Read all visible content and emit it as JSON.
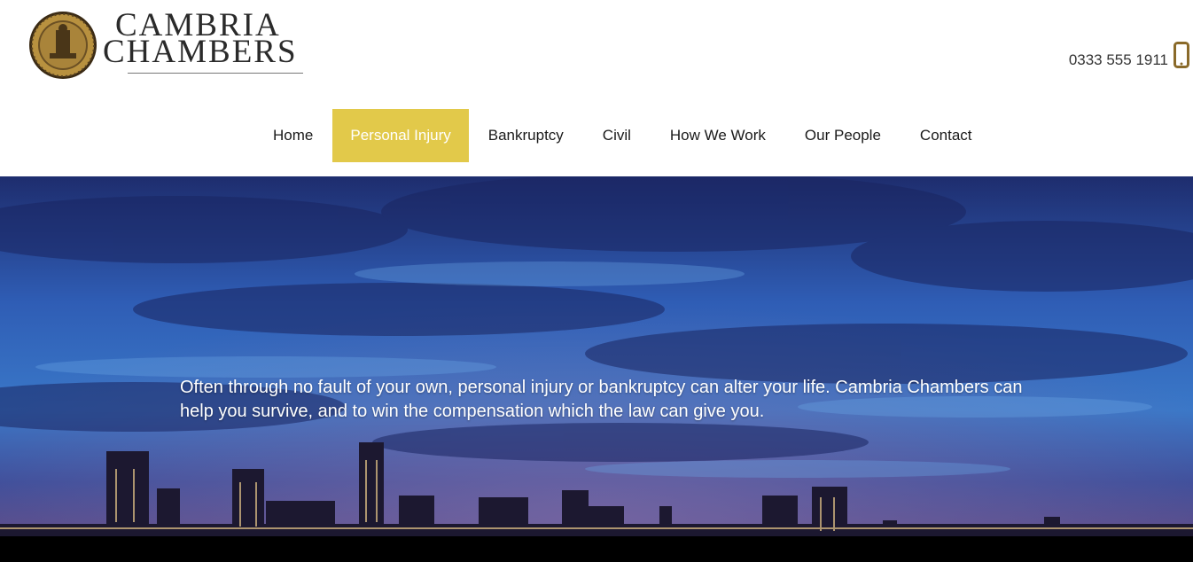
{
  "brand": {
    "line1": "CAMBRIA",
    "line2": "CHAMBERS",
    "gold": "#8a6a2a"
  },
  "contact": {
    "phone": "0333 555 1911",
    "icon": "smartphone-icon"
  },
  "nav": {
    "items": [
      {
        "label": "Home"
      },
      {
        "label": "Personal Injury",
        "active": true
      },
      {
        "label": "Bankruptcy"
      },
      {
        "label": "Civil"
      },
      {
        "label": "How We Work"
      },
      {
        "label": "Our People"
      },
      {
        "label": "Contact"
      }
    ],
    "active_color": "#e2c94a"
  },
  "hero": {
    "text": "Often through no fault of your own, personal injury or bankruptcy can alter your life. Cambria Chambers can help you survive, and to win the compensation which the law can give you."
  }
}
